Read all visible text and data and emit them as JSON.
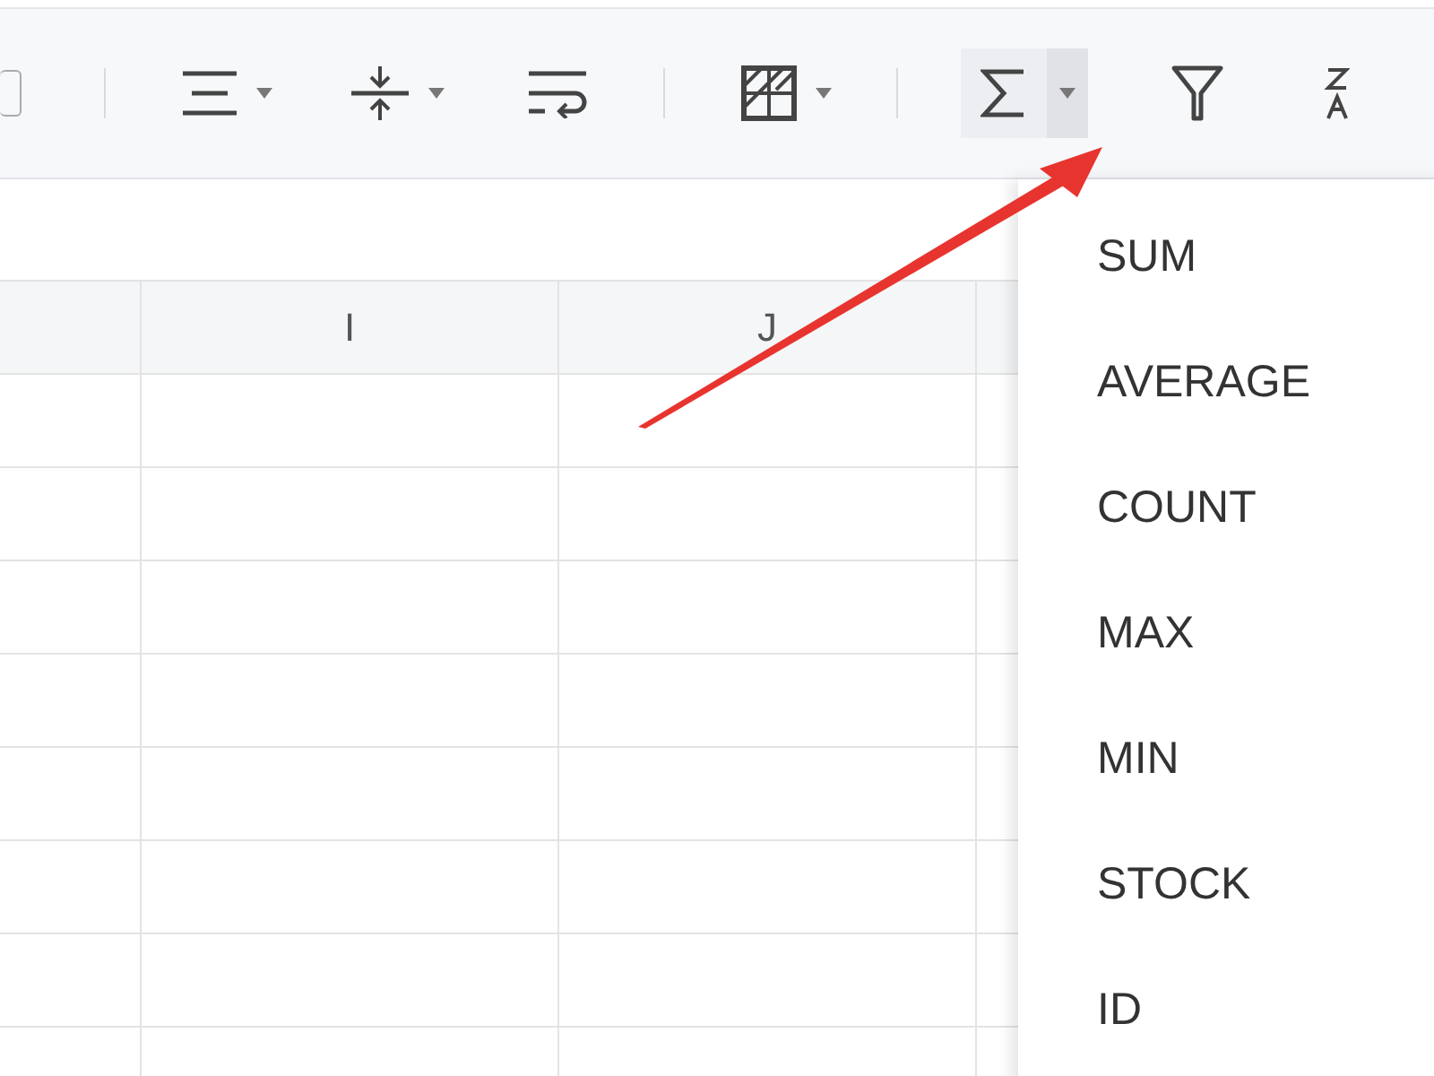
{
  "toolbar": {
    "sum_button": {
      "pressed": true
    }
  },
  "sheet": {
    "columns": [
      {
        "label": "I"
      },
      {
        "label": "J"
      }
    ]
  },
  "dropdown": {
    "items": [
      {
        "label": "SUM"
      },
      {
        "label": "AVERAGE"
      },
      {
        "label": "COUNT"
      },
      {
        "label": "MAX"
      },
      {
        "label": "MIN"
      },
      {
        "label": "STOCK"
      },
      {
        "label": "ID"
      }
    ]
  }
}
